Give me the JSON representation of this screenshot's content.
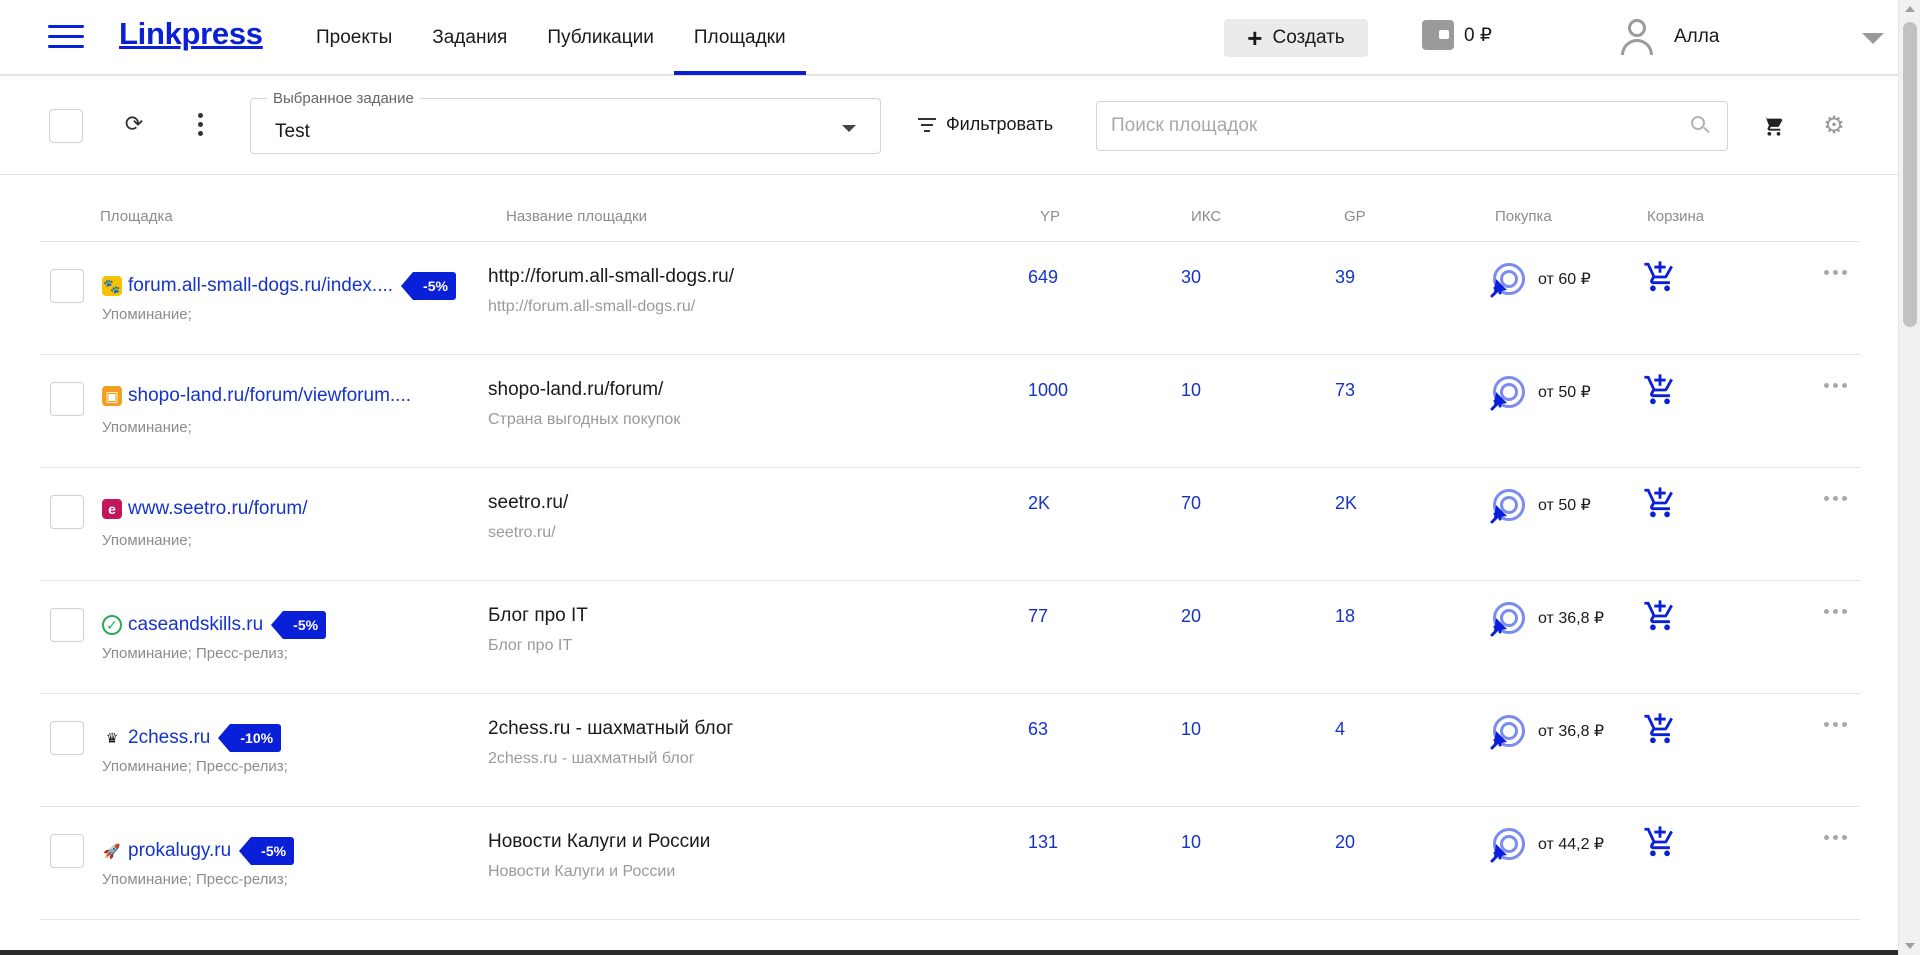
{
  "colors": {
    "accent": "#0a1fd8",
    "link": "#1533c9",
    "muted": "#8c8c8c",
    "target": "#7b8cf0"
  },
  "header": {
    "logo": "Linkpress",
    "nav": [
      {
        "label": "Проекты",
        "active": false
      },
      {
        "label": "Задания",
        "active": false
      },
      {
        "label": "Публикации",
        "active": false
      },
      {
        "label": "Площадки",
        "active": true
      }
    ],
    "create_label": "Создать",
    "balance": "0 ₽",
    "user_name": "Алла"
  },
  "toolbar": {
    "task_label": "Выбранное задание",
    "task_value": "Test",
    "filter_label": "Фильтровать",
    "search_placeholder": "Поиск площадок"
  },
  "table": {
    "headers": {
      "site": "Площадка",
      "name": "Название площадки",
      "yp": "YP",
      "iks": "ИКС",
      "gp": "GP",
      "buy": "Покупка",
      "cart": "Корзина"
    },
    "rows": [
      {
        "site": "forum.all-small-dogs.ru/index....",
        "favicon": "paw-icon",
        "discount": "-5%",
        "types": "Упоминание;",
        "title": "http://forum.all-small-dogs.ru/",
        "subtitle": "http://forum.all-small-dogs.ru/",
        "yp": "649",
        "iks": "30",
        "gp": "39",
        "price": "от 60 ₽"
      },
      {
        "site": "shopo-land.ru/forum/viewforum....",
        "favicon": "shop-bag-icon",
        "discount": "",
        "types": "Упоминание;",
        "title": "shopo-land.ru/forum/",
        "subtitle": "Страна выгодных покупок",
        "yp": "1000",
        "iks": "10",
        "gp": "73",
        "price": "от 50 ₽"
      },
      {
        "site": "www.seetro.ru/forum/",
        "favicon": "seetro-logo-icon",
        "discount": "",
        "types": "Упоминание;",
        "title": "seetro.ru/",
        "subtitle": "seetro.ru/",
        "yp": "2K",
        "iks": "70",
        "gp": "2K",
        "price": "от 50 ₽"
      },
      {
        "site": "caseandskills.ru",
        "favicon": "check-circle-icon",
        "discount": "-5%",
        "types": "Упоминание; Пресс-релиз;",
        "title": "Блог про IT",
        "subtitle": "Блог про IT",
        "yp": "77",
        "iks": "20",
        "gp": "18",
        "price": "от 36,8 ₽"
      },
      {
        "site": "2chess.ru",
        "favicon": "chess-queen-icon",
        "discount": "-10%",
        "types": "Упоминание; Пресс-релиз;",
        "title": "2chess.ru - шахматный блог",
        "subtitle": "2chess.ru - шахматный блог",
        "yp": "63",
        "iks": "10",
        "gp": "4",
        "price": "от 36,8 ₽"
      },
      {
        "site": "prokalugy.ru",
        "favicon": "rocket-icon",
        "discount": "-5%",
        "types": "Упоминание; Пресс-релиз;",
        "title": "Новости Калуги и России",
        "subtitle": "Новости Калуги и России",
        "yp": "131",
        "iks": "10",
        "gp": "20",
        "price": "от 44,2 ₽"
      }
    ]
  }
}
